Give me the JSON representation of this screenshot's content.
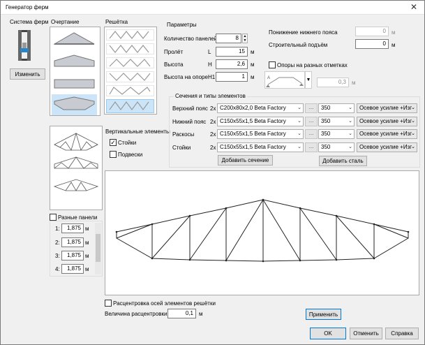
{
  "window": {
    "title": "Генератор ферм",
    "close": "✕"
  },
  "system": {
    "label": "Система ферм",
    "change_btn": "Изменить"
  },
  "outline": {
    "label": "Очертание"
  },
  "lattice": {
    "label": "Решётка"
  },
  "vertical": {
    "label": "Вертикальные элементы",
    "posts": "Стойки",
    "hangers": "Подвески"
  },
  "params": {
    "label": "Параметры",
    "panels_label": "Количество панелей",
    "panels_value": "8",
    "span_label": "Пролёт",
    "span_sym": "L",
    "span_value": "15",
    "span_unit": "м",
    "height_label": "Высота",
    "height_sym": "H",
    "height_value": "2,6",
    "height_unit": "м",
    "support_label": "Высота на опоре",
    "support_sym": "H1",
    "support_value": "1",
    "support_unit": "м",
    "lower_drop_label": "Понижение нижнего пояса",
    "lower_drop_value": "0",
    "lower_drop_unit": "м",
    "camber_label": "Строительный подъём",
    "camber_value": "0",
    "camber_unit": "м",
    "supports_diff_label": "Опоры на разных отметках",
    "supports_diff_value": "0,3",
    "supports_diff_unit": "м"
  },
  "sections": {
    "label": "Сечения и типы элементов",
    "rows": [
      {
        "name": "Верхний пояс",
        "count": "2x",
        "profile": "C200x80x2,0 Beta Factory",
        "steel": "350",
        "force": "Осевое усилие +Изг"
      },
      {
        "name": "Нижний пояс",
        "count": "2x",
        "profile": "C150x55x1,5 Beta Factory",
        "steel": "350",
        "force": "Осевое усилие +Изг"
      },
      {
        "name": "Раскосы",
        "count": "2x",
        "profile": "C150x55x1,5 Beta Factory",
        "steel": "350",
        "force": "Осевое усилие +Изг"
      },
      {
        "name": "Стойки",
        "count": "2x",
        "profile": "C150x55x1,5 Beta Factory",
        "steel": "350",
        "force": "Осевое усилие +Изг"
      }
    ],
    "dots": "...",
    "add_section": "Добавить сечение",
    "add_steel": "Добавить сталь"
  },
  "panels": {
    "label": "Разные панели",
    "rows": [
      {
        "idx": "1:",
        "value": "1,875",
        "unit": "м"
      },
      {
        "idx": "2:",
        "value": "1,875",
        "unit": "м"
      },
      {
        "idx": "3:",
        "value": "1,875",
        "unit": "м"
      },
      {
        "idx": "4:",
        "value": "1,875",
        "unit": "м"
      }
    ]
  },
  "offset": {
    "checkbox": "Расцентровка осей элементов решётки",
    "amount_label": "Величина расцентровки",
    "amount_value": "0,1",
    "amount_unit": "м"
  },
  "buttons": {
    "apply": "Применить",
    "ok": "OK",
    "cancel": "Отменить",
    "help": "Справка"
  },
  "colors": {
    "selected": "#cce4f7",
    "default_border": "#0078d7"
  }
}
